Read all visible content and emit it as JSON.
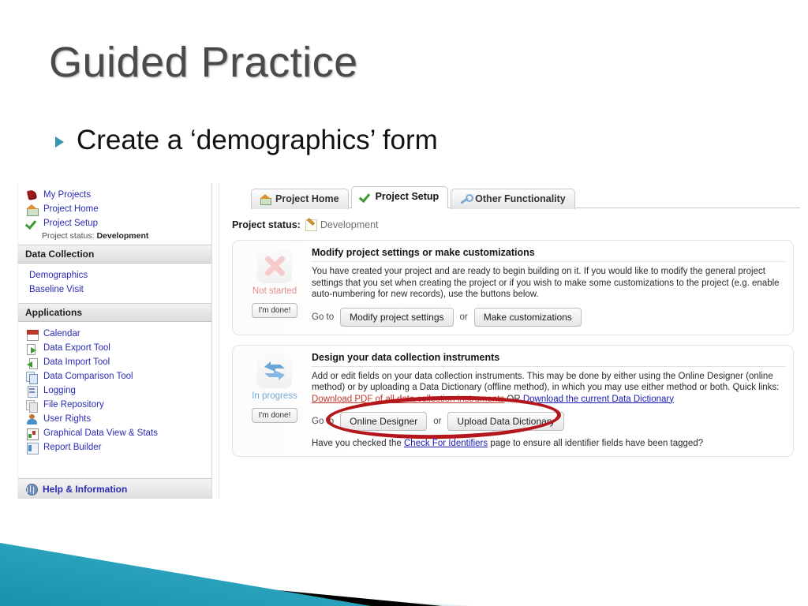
{
  "slide": {
    "title": "Guided Practice",
    "bullet": "Create a ‘demographics’ form",
    "accent_teal": "#3497ab",
    "title_color": "#4a4a4a"
  },
  "screenshot": {
    "sidebar": {
      "top_links": [
        {
          "label": "My Projects",
          "icon": "bookmark-icon"
        },
        {
          "label": "Project Home",
          "icon": "house-icon"
        },
        {
          "label": "Project Setup",
          "icon": "green-check-icon"
        }
      ],
      "project_status_label": "Project status:",
      "project_status_value": "Development",
      "data_collection_header": "Data Collection",
      "data_collection_items": [
        {
          "label": "Demographics"
        },
        {
          "label": "Baseline Visit"
        }
      ],
      "applications_header": "Applications",
      "applications_items": [
        {
          "label": "Calendar",
          "icon": "calendar-icon"
        },
        {
          "label": "Data Export Tool",
          "icon": "export-icon"
        },
        {
          "label": "Data Import Tool",
          "icon": "import-icon"
        },
        {
          "label": "Data Comparison Tool",
          "icon": "pages-icon"
        },
        {
          "label": "Logging",
          "icon": "log-icon"
        },
        {
          "label": "File Repository",
          "icon": "grey-pages-icon"
        },
        {
          "label": "User Rights",
          "icon": "user-icon"
        },
        {
          "label": "Graphical Data View & Stats",
          "icon": "chart-icon"
        },
        {
          "label": "Report Builder",
          "icon": "report-icon"
        }
      ],
      "help_label": "Help & Information"
    },
    "tabs": [
      {
        "label": "Project Home",
        "icon": "house-icon",
        "active": false
      },
      {
        "label": "Project Setup",
        "icon": "green-check-icon",
        "active": true
      },
      {
        "label": "Other Functionality",
        "icon": "wrench-icon",
        "active": false
      }
    ],
    "project_status": {
      "label": "Project status:",
      "value": "Development"
    },
    "cards": [
      {
        "status_label": "Not started",
        "status_icon": "red-x-icon",
        "done_button": "I'm done!",
        "title": "Modify project settings or make customizations",
        "body": "You have created your project and are ready to begin building on it. If you would like to modify the general project settings that you set when creating the project or if you wish to make some customizations to the project (e.g. enable auto-numbering for new records), use the buttons below.",
        "goto_label": "Go to",
        "primary_button": "Modify project settings",
        "or_label": "or",
        "secondary_button": "Make customizations"
      },
      {
        "status_label": "In progress",
        "status_icon": "blue-refresh-icon",
        "done_button": "I'm done!",
        "title": "Design your data collection instruments",
        "body_line1": "Add or edit fields on your data collection instruments. This may be done by either using the Online Designer",
        "body_line2": "(online method) or by uploading a Data Dictionary (offline method), in which you may use either method or both.",
        "quick_links_label": "Quick links:",
        "quick_link_1": "Download PDF of all data collection instruments",
        "quick_links_or": "OR",
        "quick_link_2": "Download the current Data Dictionary",
        "goto_label": "Go to",
        "primary_button": "Online Designer",
        "or_label": "or",
        "secondary_button": "Upload Data Dictionary",
        "footer_pre": "Have you checked the",
        "footer_link": "Check For Identifiers",
        "footer_post": "page to ensure all identifier fields have been tagged?"
      }
    ],
    "annotation": {
      "type": "red-ellipse",
      "color": "#b5161c"
    }
  }
}
